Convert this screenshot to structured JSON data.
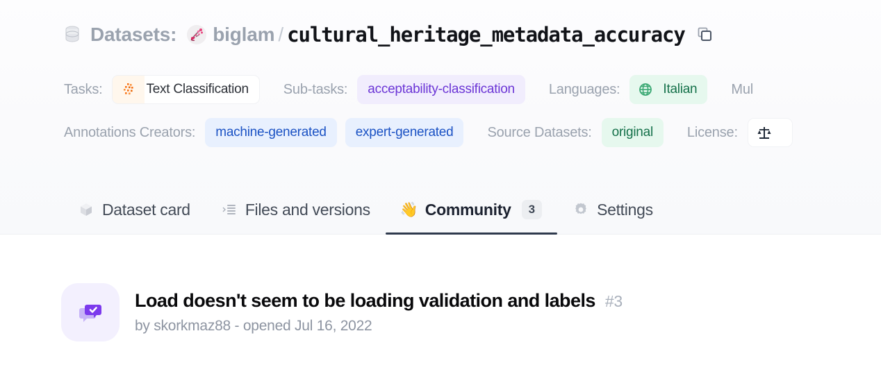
{
  "header": {
    "db_icon": "database-icon",
    "datasets_label": "Datasets:",
    "org_name": "biglam",
    "separator": "/",
    "repo_name": "cultural_heritage_metadata_accuracy",
    "copy_icon": "copy-icon"
  },
  "meta": {
    "row1": {
      "tasks_label": "Tasks:",
      "tasks_tag": "Text Classification",
      "subtasks_label": "Sub-tasks:",
      "subtasks_tag": "acceptability-classification",
      "languages_label": "Languages:",
      "languages_tag": "Italian",
      "multilinguality_label": "Mul"
    },
    "row2": {
      "annotations_label": "Annotations Creators:",
      "annotations_tag1": "machine-generated",
      "annotations_tag2": "expert-generated",
      "source_label": "Source Datasets:",
      "source_tag": "original",
      "license_label": "License:",
      "license_tag": ""
    }
  },
  "tabs": [
    {
      "label": "Dataset card",
      "icon": "cube-icon",
      "active": false,
      "count": null
    },
    {
      "label": "Files and versions",
      "icon": "file-list-icon",
      "active": false,
      "count": null
    },
    {
      "label": "Community",
      "icon": "waving-hand-icon",
      "active": true,
      "count": "3"
    },
    {
      "label": "Settings",
      "icon": "gear-icon",
      "active": false,
      "count": null
    }
  ],
  "discussions": [
    {
      "icon": "discussion-check-icon",
      "title": "Load doesn't seem to be loading validation and labels",
      "number": "#3",
      "subtitle": "by skorkmaz88 - opened Jul 16, 2022"
    }
  ],
  "colors": {
    "accent_purple": "#6b35d6",
    "tag_green_text": "#15714a",
    "tag_blue_text": "#1b52c4",
    "active_tab_underline": "#2f3a4d",
    "muted_text": "#9aa2ae"
  }
}
